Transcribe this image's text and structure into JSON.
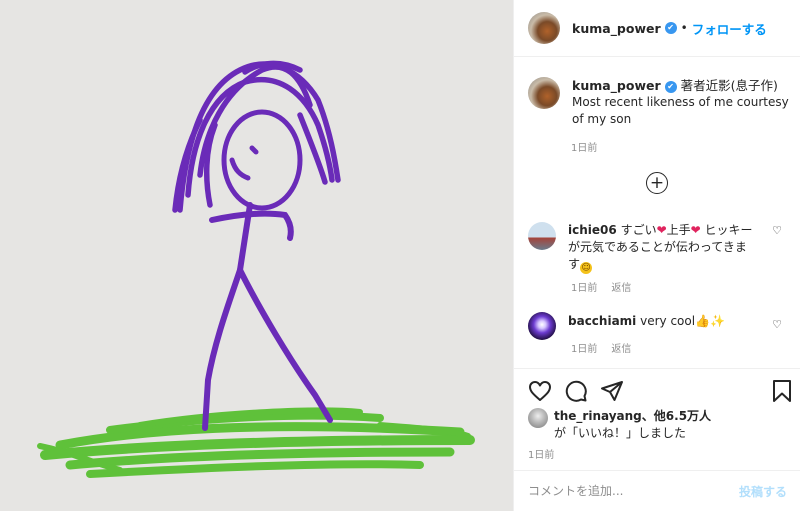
{
  "post": {
    "image_alt": "child's stick figure drawing"
  },
  "header": {
    "username": "kuma_power",
    "verified_glyph": "✔",
    "separator": "•",
    "follow_label": "フォローする"
  },
  "caption": {
    "username": "kuma_power",
    "verified_glyph": "✔",
    "title": "著者近影(息子作)",
    "text": "Most recent likeness of me courtesy of my son",
    "time": "1日前"
  },
  "load_more": {
    "icon": "plus-circle-icon",
    "glyph": "+"
  },
  "comments": [
    {
      "username": "ichie06",
      "text_a": "すごい",
      "emoji_a": "❤",
      "text_b": "上手",
      "emoji_b": "❤",
      "text_c": "ヒッキーが元気であることが伝わってきます",
      "emoji_c": "☺",
      "time": "1日前",
      "reply_label": "返信",
      "like_glyph": "♡"
    },
    {
      "username": "bacchiami",
      "text": "very cool",
      "emoji_a": "👍",
      "emoji_b": "✨",
      "time": "1日前",
      "reply_label": "返信",
      "like_glyph": "♡"
    }
  ],
  "actions": {
    "like_icon": "heart-icon",
    "comment_icon": "comment-icon",
    "share_icon": "share-icon",
    "save_icon": "bookmark-icon"
  },
  "likes": {
    "user": "the_rinayang",
    "separator": "、",
    "others": "他6.5万人",
    "suffix": "が「いいね！」しました"
  },
  "post_time": "1日前",
  "add_comment": {
    "placeholder": "コメントを追加...",
    "post_label": "投稿する"
  },
  "colors": {
    "accent": "#0095f6",
    "drawing_purple": "#6a2bb8",
    "drawing_green": "#5fc13a",
    "emoji_heart": "#e0245e",
    "emoji_yellow": "#f4c21a"
  }
}
